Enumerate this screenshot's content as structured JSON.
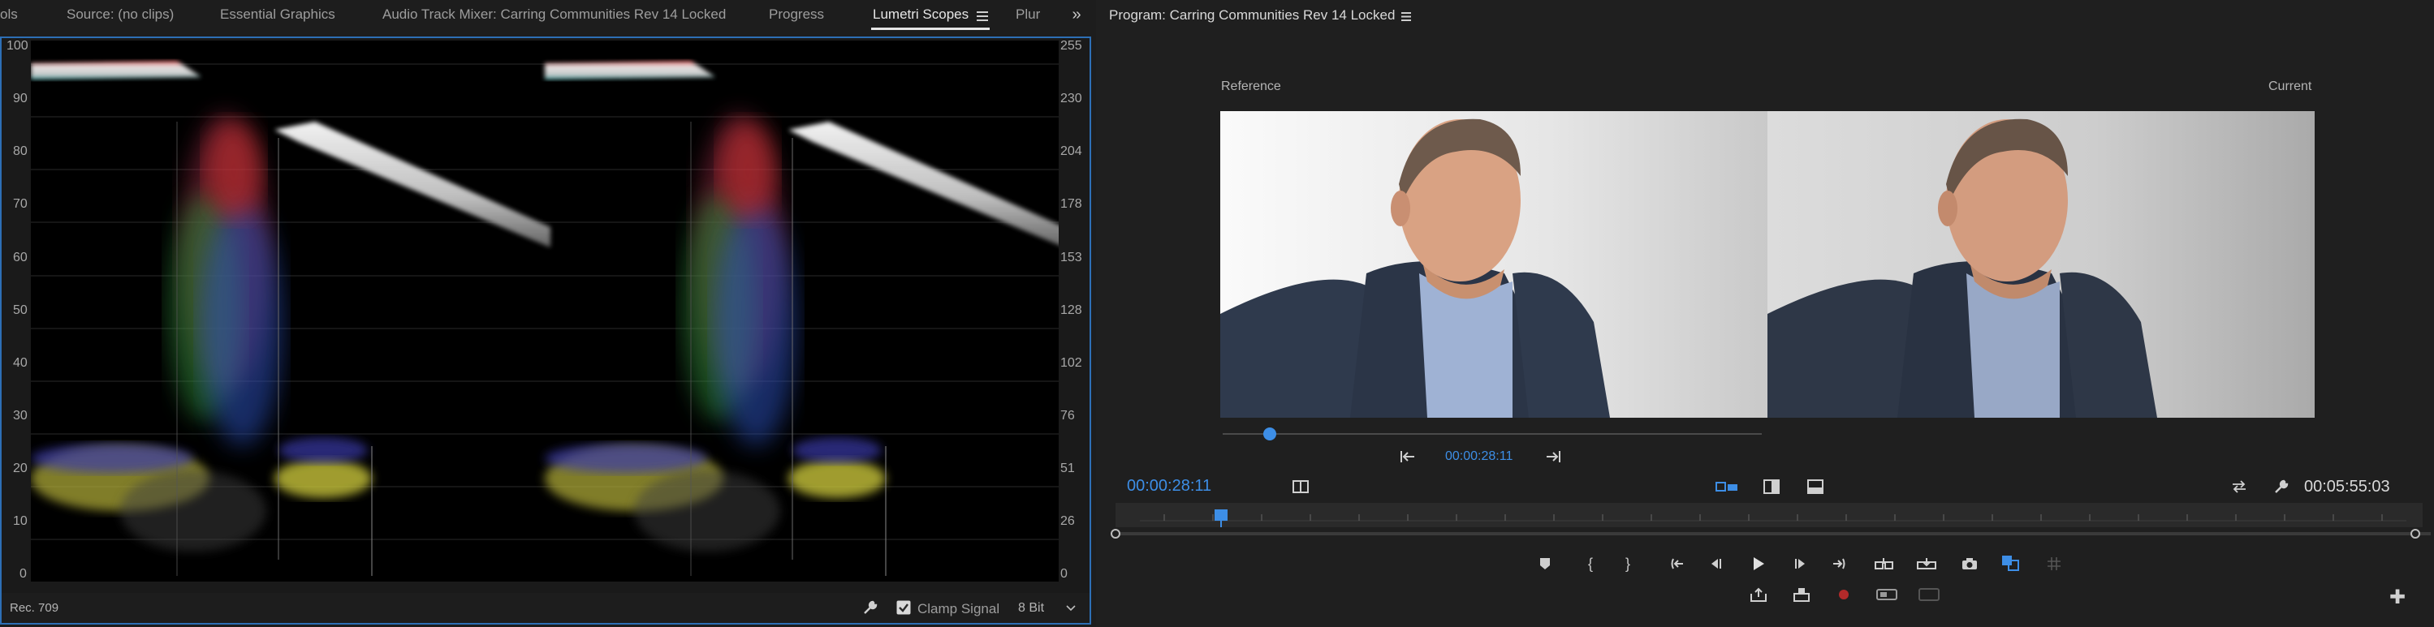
{
  "tabs": [
    {
      "label": "ols"
    },
    {
      "label": "Source: (no clips)"
    },
    {
      "label": "Essential Graphics"
    },
    {
      "label": "Audio Track Mixer: Carring Communities Rev 14 Locked"
    },
    {
      "label": "Progress"
    },
    {
      "label": "Lumetri Scopes"
    },
    {
      "label": "Plur"
    }
  ],
  "scope": {
    "left_ticks": [
      "100",
      "90",
      "80",
      "70",
      "60",
      "50",
      "40",
      "30",
      "20",
      "10",
      "0"
    ],
    "right_ticks": [
      "255",
      "230",
      "204",
      "178",
      "153",
      "128",
      "102",
      "76",
      "51",
      "26",
      "0"
    ],
    "colorspace": "Rec. 709",
    "clamp_label": "Clamp Signal",
    "bit_depth": "8 Bit"
  },
  "program": {
    "title": "Program: Carring Communities Rev 14 Locked",
    "reference_label": "Reference",
    "current_label": "Current",
    "ref_timecode": "00:00:28:11",
    "playhead_timecode": "00:00:28:11",
    "duration": "00:05:55:03"
  },
  "colors": {
    "accent": "#3d8ee6",
    "panel_border": "#2d6fb5",
    "record": "#b22a2a"
  }
}
